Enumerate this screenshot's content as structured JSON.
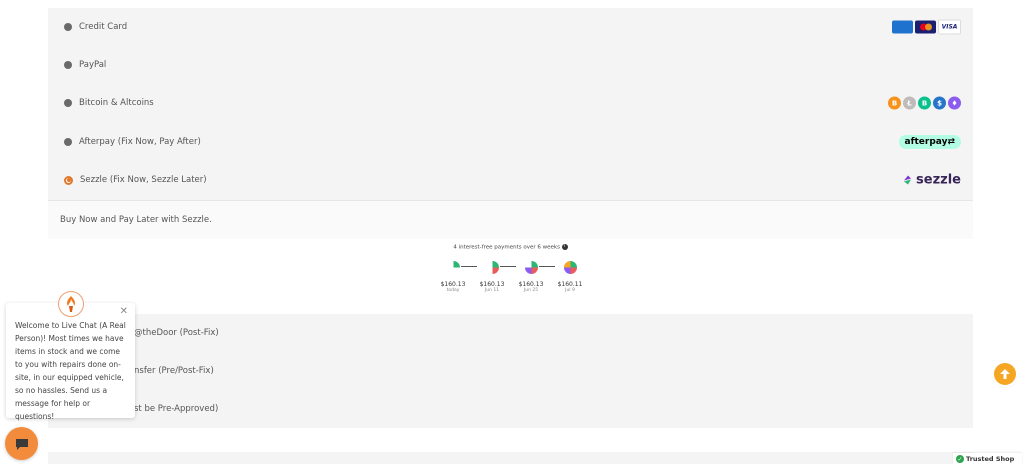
{
  "payment_options": [
    {
      "label": "Credit Card",
      "selected": false
    },
    {
      "label": "PayPal",
      "selected": false
    },
    {
      "label": "Bitcoin & Altcoins",
      "selected": false
    },
    {
      "label": "Afterpay (Fix Now, Pay After)",
      "selected": false
    },
    {
      "label": "Sezzle (Fix Now, Sezzle Later)",
      "selected": true
    }
  ],
  "card_logos": [
    "amex",
    "mastercard",
    "VISA"
  ],
  "coins": [
    {
      "icon": "bitcoin-icon",
      "color": "#f7931a",
      "glyph": "B"
    },
    {
      "icon": "litecoin-icon",
      "color": "#bfbbbb",
      "glyph": "Ł"
    },
    {
      "icon": "bitcoin-cash-icon",
      "color": "#0ac18e",
      "glyph": "B"
    },
    {
      "icon": "usdc-icon",
      "color": "#2775ca",
      "glyph": "$"
    },
    {
      "icon": "ethereum-icon",
      "color": "#8c5cf0",
      "glyph": "♦"
    }
  ],
  "afterpay_logo": "afterpay",
  "sezzle_logo": "sezzle",
  "sezzle_description": "Buy Now and Pay Later with Sezzle.",
  "sezzle_widget": {
    "headline": "4 interest-free payments over 6 weeks",
    "payments": [
      {
        "amount": "$160.13",
        "when": "today",
        "fraction": 0.25
      },
      {
        "amount": "$160.13",
        "when": "Jun 11",
        "fraction": 0.5
      },
      {
        "amount": "$160.13",
        "when": "Jun 25",
        "fraction": 0.75
      },
      {
        "amount": "$160.11",
        "when": "Jul 9",
        "fraction": 1.0
      }
    ]
  },
  "lower_options": [
    {
      "label": "@theDoor (Post-Fix)"
    },
    {
      "label": "nsfer (Pre/Post-Fix)"
    },
    {
      "label": "st be Pre-Approved)"
    }
  ],
  "chat": {
    "message": "Welcome to Live Chat (A Real Person)! Most times we have items in stock and we come to you with repairs done on-site, in our equipped vehicle, so no hassles. Send us a message for help or questions!",
    "close_glyph": "✕"
  },
  "trusted_shop": "Trusted Shop",
  "colors": {
    "accent": "#e07a2c",
    "sezzle_purple": "#392558",
    "afterpay_mint": "#b2fce4",
    "chat_orange": "#f38b3c",
    "scroll_top": "#f5a623"
  }
}
